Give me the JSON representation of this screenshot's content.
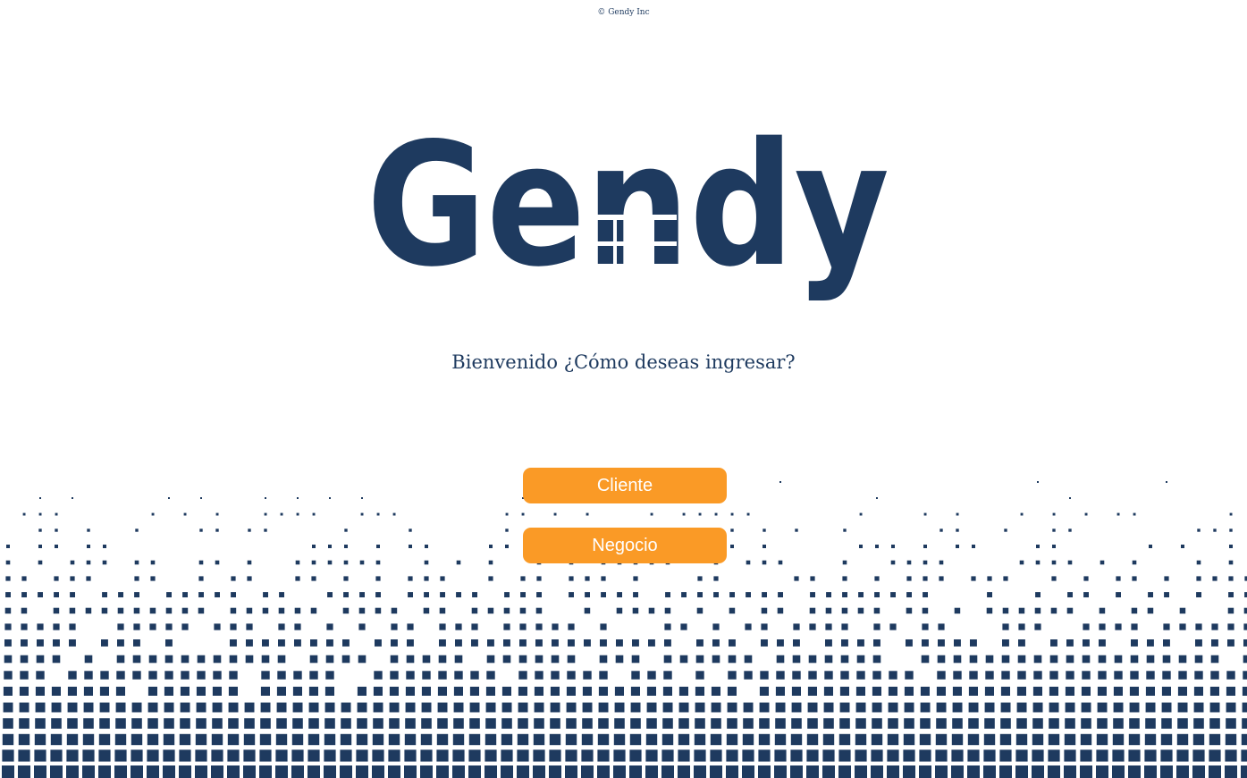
{
  "footer": {
    "copyright": "© Gendy Inc"
  },
  "brand": {
    "logo_text": "Gendy",
    "color_primary": "#1e3a5f",
    "color_accent": "#fa9a26"
  },
  "main": {
    "welcome_text": "Bienvenido ¿Cómo deseas ingresar?",
    "buttons": {
      "cliente_label": "Cliente",
      "negocio_label": "Negocio"
    }
  },
  "decoration": {
    "pattern_icon": "halftone-square-pattern"
  }
}
